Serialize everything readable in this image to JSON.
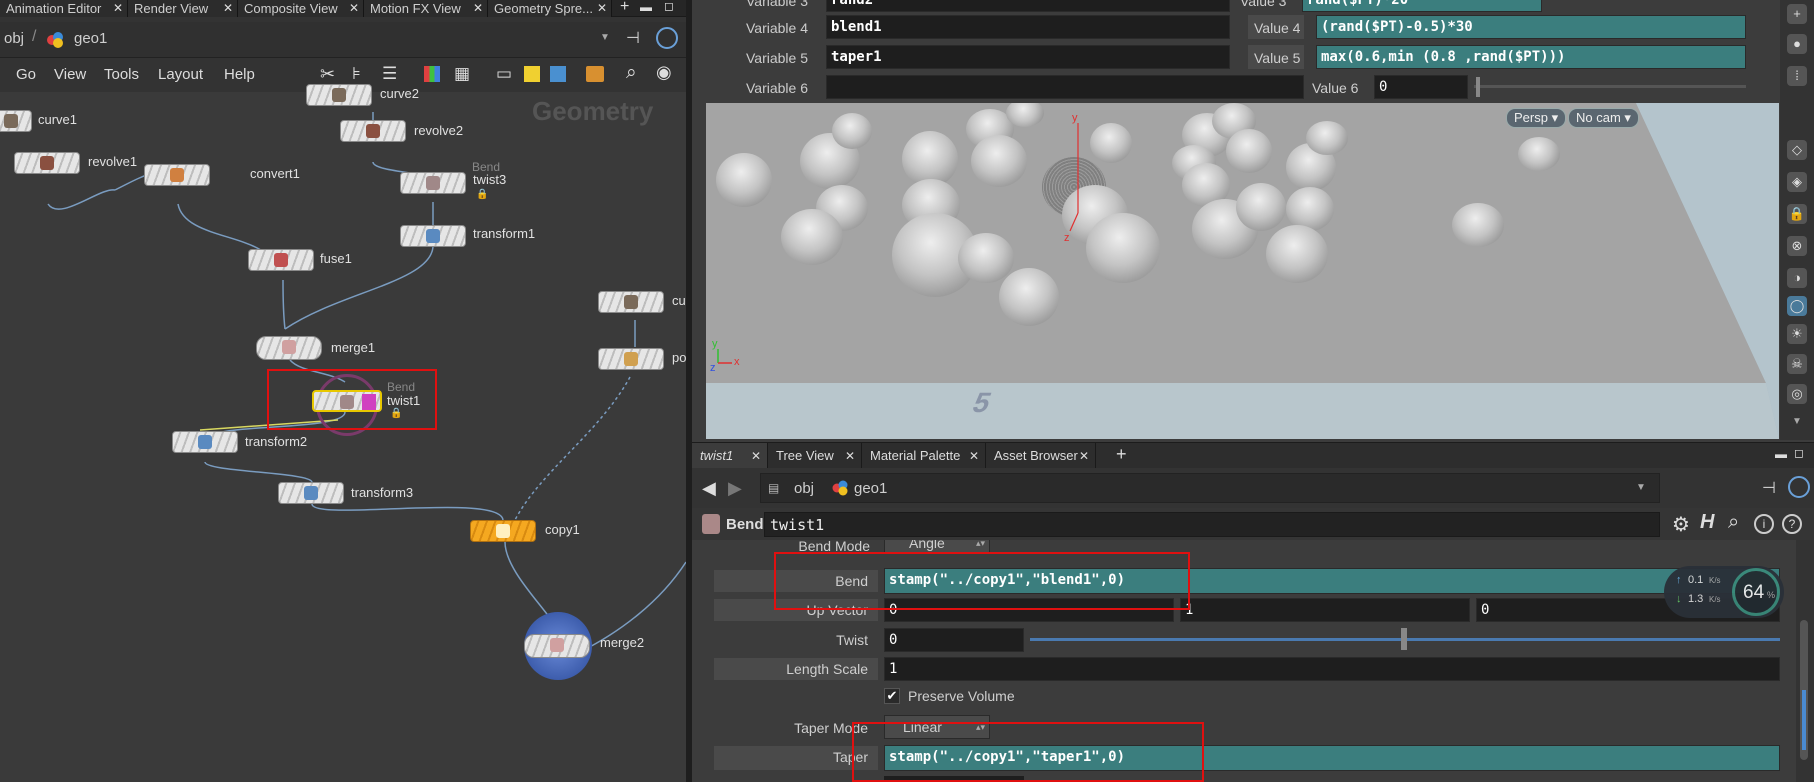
{
  "left_tabs": [
    "Animation Editor",
    "Render View",
    "Composite View",
    "Motion FX View",
    "Geometry Spre..."
  ],
  "path": {
    "obj": "obj",
    "geo": "geo1"
  },
  "menu": [
    "Go",
    "View",
    "Tools",
    "Layout",
    "Help"
  ],
  "network": {
    "watermark": "Geometry",
    "nodes": {
      "curve1": "curve1",
      "curve2": "curve2",
      "revolve1": "revolve1",
      "revolve2": "revolve2",
      "convert1": "convert1",
      "twist3": "twist3",
      "twist3_type": "Bend",
      "transform1": "transform1",
      "fuse1": "fuse1",
      "merge1": "merge1",
      "twist1": "twist1",
      "twist1_type": "Bend",
      "transform2": "transform2",
      "transform3": "transform3",
      "copy1": "copy1",
      "merge2": "merge2",
      "cu": "cu",
      "po": "po"
    }
  },
  "variables": {
    "label3": "Variable 3",
    "name3": "rand2",
    "vlabel3": "Value 3",
    "value3": "rand($PT)*20",
    "label4": "Variable 4",
    "name4": "blend1",
    "vlabel4": "Value 4",
    "value4": "(rand($PT)-0.5)*30",
    "label5": "Variable 5",
    "name5": "taper1",
    "vlabel5": "Value 5",
    "value5": "max(0.6,min (0.8 ,rand($PT)))",
    "label6": "Variable 6",
    "name6": "",
    "vlabel6": "Value 6",
    "value6": "0"
  },
  "viewport": {
    "persp": "Persp",
    "cam": "No cam",
    "grid_num": "5"
  },
  "panel_tabs": [
    "twist1",
    "Tree View",
    "Material Palette",
    "Asset Browser"
  ],
  "panel_path": {
    "obj": "obj",
    "geo": "geo1"
  },
  "node_header": {
    "type": "Bend",
    "name": "twist1"
  },
  "parms": {
    "bend_mode_label": "Bend Mode",
    "bend_mode": "Angle",
    "bend_label": "Bend",
    "bend": "stamp(\"../copy1\",\"blend1\",0)",
    "upvector_label": "Up Vector",
    "upvector": [
      "0",
      "1",
      "0"
    ],
    "twist_label": "Twist",
    "twist": "0",
    "length_label": "Length Scale",
    "length": "1",
    "preserve_label": "Preserve Volume",
    "taper_mode_label": "Taper Mode",
    "taper_mode": "Linear",
    "taper_label": "Taper",
    "taper": "stamp(\"../copy1\",\"taper1\",0)"
  },
  "perf": {
    "up": "0.1",
    "down": "1.3",
    "unit": "K/s",
    "percent": "64",
    "pct_sign": "%"
  }
}
